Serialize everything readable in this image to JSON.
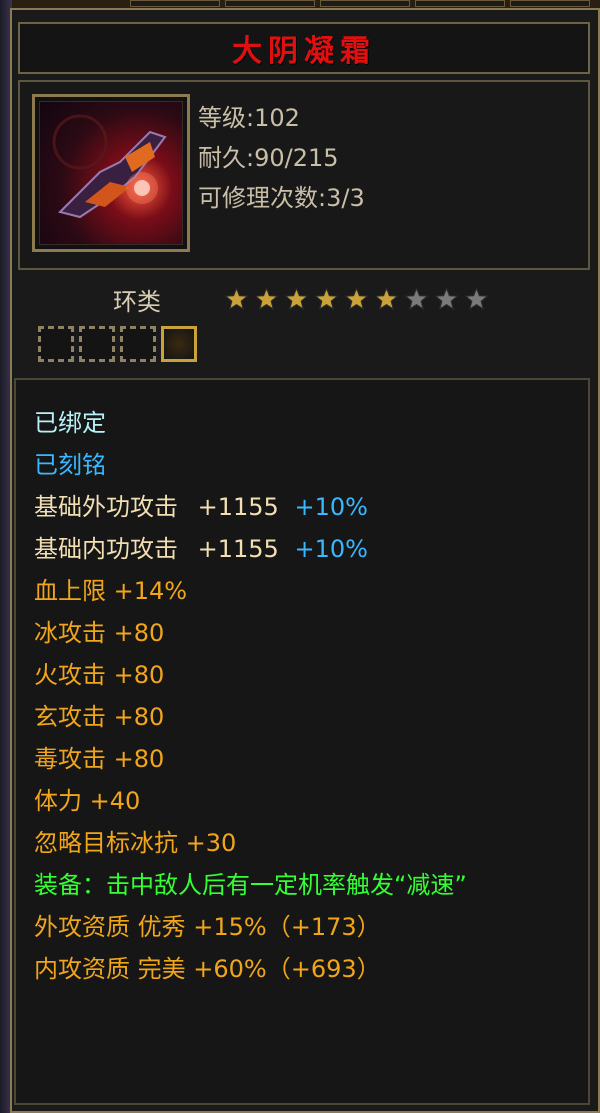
{
  "item": {
    "name": "大阴凝霜",
    "level": "等级:102",
    "durability": "耐久:90/215",
    "repairs": "可修理次数:3/3",
    "category": "环类",
    "stars_filled": 6,
    "stars_total": 9,
    "slots_filled": 1,
    "slots_total": 4
  },
  "status": {
    "bound": "已绑定",
    "engraved": "已刻铭"
  },
  "stats": {
    "ext_attack_label": "基础外功攻击",
    "ext_attack_value": "+1155",
    "ext_attack_bonus": "+10%",
    "int_attack_label": "基础内功攻击",
    "int_attack_value": "+1155",
    "int_attack_bonus": "+10%",
    "hp": "血上限 +14%",
    "ice": "冰攻击 +80",
    "fire": "火攻击 +80",
    "mystic": "玄攻击 +80",
    "poison": "毒攻击 +80",
    "stamina": "体力 +40",
    "ignore_ice": "忽略目标冰抗 +30",
    "equip_effect": "装备：击中敌人后有一定机率触发“减速”",
    "ext_quality": "外攻资质  优秀 +15%（+173）",
    "int_quality": "内攻资质  完美 +60%（+693）"
  },
  "colors": {
    "title": "#e01010",
    "cyan": "#b8f0f8",
    "blue": "#39b8ff",
    "beige": "#f2dfb2",
    "gold": "#f1a51b",
    "green": "#33ff33",
    "star_gold": "#c9a23a",
    "star_gray": "#7a7a7a"
  }
}
